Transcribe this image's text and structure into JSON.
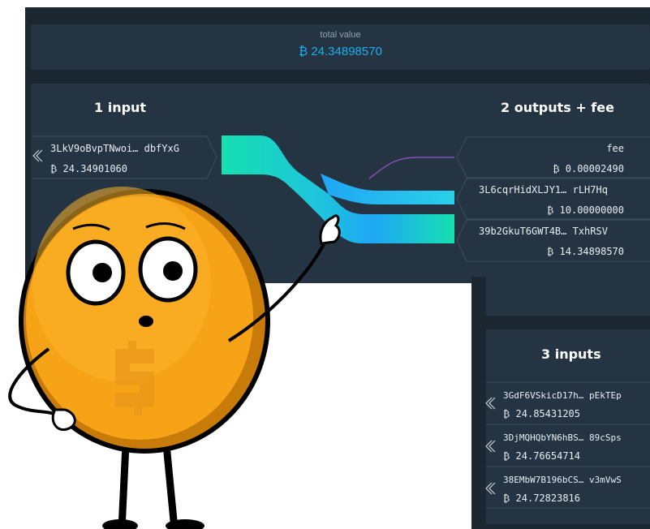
{
  "summary": {
    "total_label": "total value",
    "total_value": "₿ 24.34898570"
  },
  "flow": {
    "inputs_header": "1 input",
    "outputs_header": "2 outputs + fee",
    "inputs": [
      {
        "address": "3LkV9oBvpTNwoi… dbfYxG",
        "amount": "₿ 24.34901060"
      }
    ],
    "outputs": [
      {
        "address": "fee",
        "amount": "₿ 0.00002490"
      },
      {
        "address": "3L6cqrHidXLJY1… rLH7Hq",
        "amount": "₿ 10.00000000"
      },
      {
        "address": "39b2GkuT6GWT4B… TxhRSV",
        "amount": "₿ 14.34898570"
      }
    ]
  },
  "second_tx": {
    "inputs_header": "3 inputs",
    "inputs": [
      {
        "address": "3GdF6VSkicD17h… pEkTEp",
        "amount": "₿ 24.85431205"
      },
      {
        "address": "3DjMQHQbYN6hBS… 89cSps",
        "amount": "₿ 24.76654714"
      },
      {
        "address": "38EMbW7B196bCS… v3mVwS",
        "amount": "₿ 24.72823816"
      }
    ]
  },
  "icons": {
    "expand_input": "double-chevron-left-icon",
    "mascot": "coin-mascot-illustration"
  },
  "colors": {
    "bg_dark": "#1b2731",
    "panel": "#243442",
    "accent_blue": "#1daeee",
    "flow_green": "#16e0b0",
    "flow_blue": "#1fa6f5",
    "fee_purple": "#8a4fb8",
    "coin_orange": "#f7a317"
  }
}
